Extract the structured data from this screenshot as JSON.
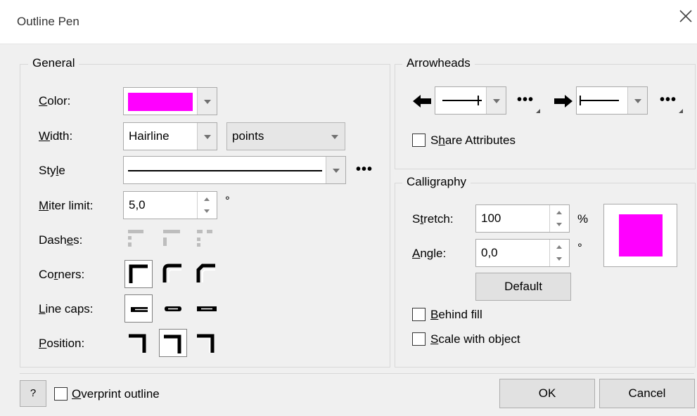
{
  "window": {
    "title": "Outline Pen"
  },
  "general": {
    "legend": "General",
    "color": {
      "label": "Color:",
      "value": "#ff00ff"
    },
    "width": {
      "label": "Width:",
      "value": "Hairline",
      "units": "points"
    },
    "style": {
      "label": "Style"
    },
    "miter": {
      "label": "Miter limit:",
      "value": "5,0",
      "unit": "°"
    },
    "dashes": {
      "label": "Dashes:"
    },
    "corners": {
      "label": "Corners:"
    },
    "linecaps": {
      "label": "Line caps:"
    },
    "position": {
      "label": "Position:"
    }
  },
  "arrowheads": {
    "legend": "Arrowheads",
    "share": "Share Attributes"
  },
  "calligraphy": {
    "legend": "Calligraphy",
    "stretch": {
      "label": "Stretch:",
      "value": "100",
      "unit": "%"
    },
    "angle": {
      "label": "Angle:",
      "value": "0,0",
      "unit": "°"
    },
    "default_btn": "Default",
    "preview_color": "#ff00ff"
  },
  "options": {
    "behind_fill": "Behind fill",
    "scale_with_object": "Scale with object"
  },
  "footer": {
    "help": "?",
    "overprint": "Overprint outline",
    "ok": "OK",
    "cancel": "Cancel"
  },
  "more_label": "•••"
}
